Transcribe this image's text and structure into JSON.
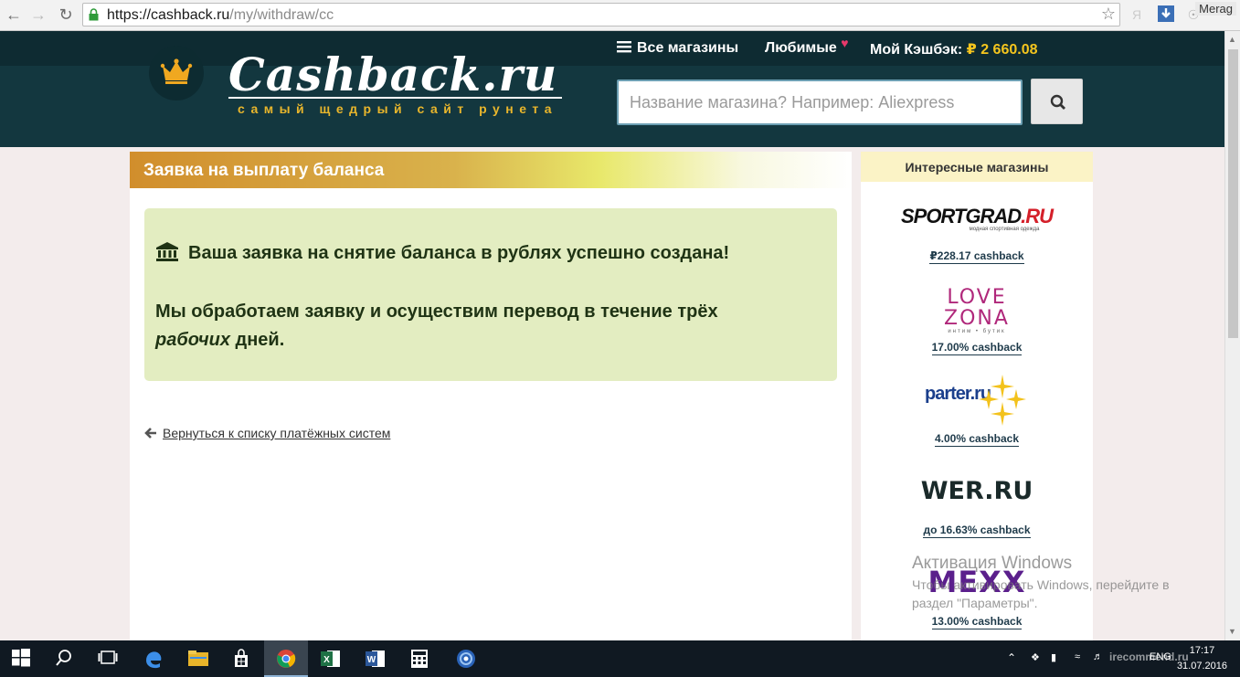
{
  "browser": {
    "url_base": "https://cashback.ru",
    "url_path": "/my/withdraw/cc",
    "profile_name": "Merag",
    "icons": [
      "back-arrow-icon",
      "forward-arrow-icon",
      "reload-icon",
      "lock-icon",
      "star-icon",
      "yandex-icon",
      "download-icon",
      "extension-icon"
    ]
  },
  "header": {
    "logo_text": "Cashback.ru",
    "logo_tagline": "самый щедрый сайт рунета",
    "all_stores_label": "Все магазины",
    "favorites_label": "Любимые",
    "my_cashback_label": "Мой Кэшбэк:",
    "balance": "₽ 2 660.08",
    "search_placeholder": "Название магазина? Например: Aliexpress",
    "colors": {
      "header_bg": "#13373f",
      "accent_gold": "#f4c51e",
      "heart": "#e8396b"
    }
  },
  "main": {
    "panel_title": "Заявка на выплату баланса",
    "success_title": "Ваша заявка на снятие баланса в рублях успешно создана!",
    "success_text_before": "Мы обработаем заявку и осуществим перевод в течение трёх ",
    "success_text_italic": "рабочих",
    "success_text_after": " дней.",
    "back_link": "Вернуться к списку платёжных систем"
  },
  "sidebar": {
    "title": "Интересные магазины",
    "stores": [
      {
        "name": "SPORTGRAD.RU",
        "sub": "модная спортивная одежда",
        "cashback": "₽228.17 cashback"
      },
      {
        "name": "LOVE ZONA",
        "sub": "интим • бутик",
        "cashback": "17.00% cashback"
      },
      {
        "name": "parter.ru",
        "cashback": "4.00% cashback"
      },
      {
        "name": "WER.RU",
        "cashback": "до 16.63% cashback"
      },
      {
        "name": "MEXX",
        "cashback": "13.00% cashback"
      }
    ]
  },
  "watermark": {
    "title": "Активация Windows",
    "line1": "Чтобы активировать Windows, перейдите в",
    "line2": "раздел \"Параметры\"."
  },
  "taskbar": {
    "apps": [
      "start-icon",
      "search-icon",
      "task-view-icon",
      "edge-icon",
      "explorer-icon",
      "store-icon",
      "chrome-icon",
      "excel-icon",
      "word-icon",
      "calculator-icon",
      "media-icon"
    ],
    "lang": "ENG",
    "time": "17:17",
    "date": "31.07.2016",
    "overlay_text": "irecommend.ru"
  }
}
